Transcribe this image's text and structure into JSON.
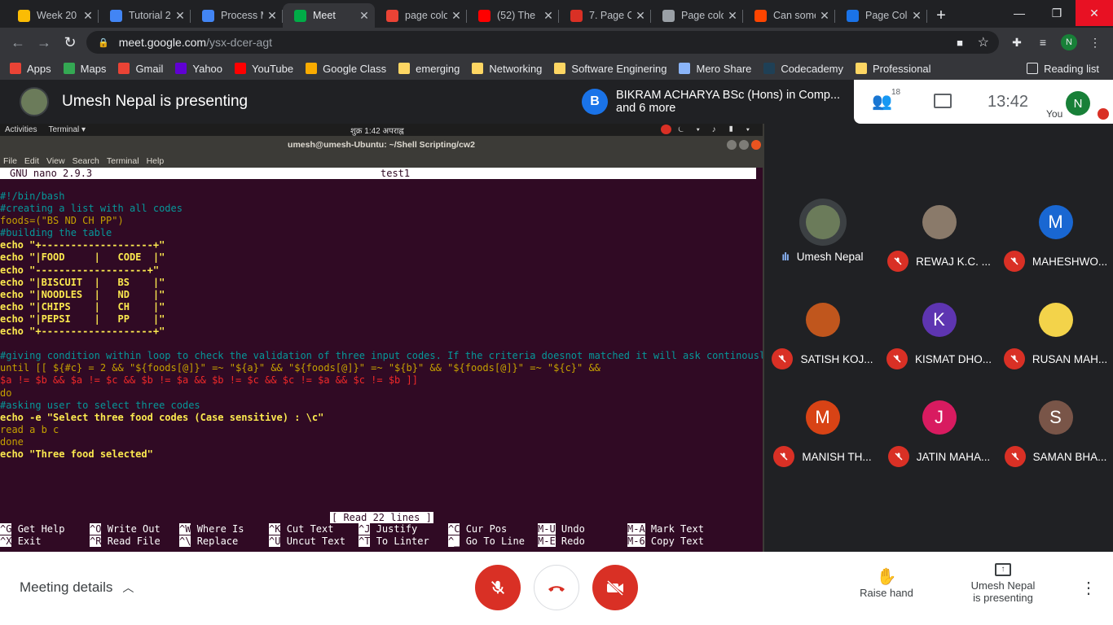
{
  "browser": {
    "tabs": [
      {
        "title": "Week 20",
        "icon": "google-drive-icon",
        "color": "#fbbc04"
      },
      {
        "title": "Tutorial 2",
        "icon": "google-docs-icon",
        "color": "#4285f4"
      },
      {
        "title": "Process M",
        "icon": "google-docs-icon",
        "color": "#4285f4"
      },
      {
        "title": "Meet",
        "icon": "google-meet-icon",
        "color": "#00ac47",
        "active": true
      },
      {
        "title": "page colo",
        "icon": "bolt-icon",
        "color": "#ea4335"
      },
      {
        "title": "(52) The",
        "icon": "youtube-icon",
        "color": "#ff0000"
      },
      {
        "title": "7. Page C",
        "icon": "red-site-icon",
        "color": "#d93025"
      },
      {
        "title": "Page colo",
        "icon": "globe-icon",
        "color": "#9aa0a6"
      },
      {
        "title": "Can some",
        "icon": "reddit-icon",
        "color": "#ff4500"
      },
      {
        "title": "Page Colo",
        "icon": "page-icon",
        "color": "#1a73e8"
      }
    ],
    "url_host": "meet.google.com",
    "url_path": "/ysx-dcer-agt",
    "profile_initial": "N",
    "bookmarks": [
      {
        "label": "Apps",
        "icon": "apps-grid-icon"
      },
      {
        "label": "Maps",
        "icon": "maps-icon"
      },
      {
        "label": "Gmail",
        "icon": "gmail-icon"
      },
      {
        "label": "Yahoo",
        "icon": "yahoo-icon"
      },
      {
        "label": "YouTube",
        "icon": "youtube-icon"
      },
      {
        "label": "Google Class",
        "icon": "classroom-icon"
      },
      {
        "label": "emerging",
        "icon": "folder-icon"
      },
      {
        "label": "Networking",
        "icon": "folder-icon"
      },
      {
        "label": "Software Enginering",
        "icon": "folder-icon"
      },
      {
        "label": "Mero Share",
        "icon": "meroshare-icon"
      },
      {
        "label": "Codecademy",
        "icon": "codecademy-icon"
      },
      {
        "label": "Professional",
        "icon": "folder-icon"
      }
    ],
    "reading_list": "Reading list"
  },
  "meet": {
    "presenter_text": "Umesh Nepal is presenting",
    "banner_initial": "B",
    "banner_line1": "BIKRAM ACHARYA BSc (Hons) in Comp...",
    "banner_line2": "and 6 more",
    "people_count": "18",
    "time": "13:42",
    "self_initial": "N",
    "self_label": "You",
    "participants": [
      {
        "name": "Umesh Nepal",
        "initial": "",
        "color": "#6b7b5a",
        "speaking": true
      },
      {
        "name": "REWAJ K.C. ...",
        "initial": "",
        "color": "#8a7a6a",
        "speaking": false
      },
      {
        "name": "MAHESHWO...",
        "initial": "M",
        "color": "#1967d2",
        "speaking": false
      },
      {
        "name": "SATISH KOJ...",
        "initial": "",
        "color": "#c0561d",
        "speaking": false
      },
      {
        "name": "KISMAT DHO...",
        "initial": "K",
        "color": "#5e35b1",
        "speaking": false
      },
      {
        "name": "RUSAN MAH...",
        "initial": "",
        "color": "#f3d34a",
        "speaking": false
      },
      {
        "name": "MANISH TH...",
        "initial": "M",
        "color": "#d84315",
        "speaking": false
      },
      {
        "name": "JATIN MAHA...",
        "initial": "J",
        "color": "#d81b60",
        "speaking": false
      },
      {
        "name": "SAMAN BHA...",
        "initial": "S",
        "color": "#795548",
        "speaking": false
      }
    ],
    "meeting_details": "Meeting details",
    "raise_hand": "Raise hand",
    "present_line1": "Umesh Nepal",
    "present_line2": "is presenting"
  },
  "terminal": {
    "activities": "Activities",
    "app_menu": "Terminal ▾",
    "clock": "शुक्र 1:42 अपराह्न",
    "title": "umesh@umesh-Ubuntu: ~/Shell Scripting/cw2",
    "menu": [
      "File",
      "Edit",
      "View",
      "Search",
      "Terminal",
      "Help"
    ],
    "nano_version": "GNU nano 2.9.3",
    "filename": "test1",
    "status": "[ Read 22 lines ]",
    "code_lines": [
      "#!/bin/bash",
      "#creating a list with all codes",
      "foods=(\"BS ND CH PP\")",
      "#building the table",
      "echo \"+-------------------+\"",
      "echo \"|FOOD     |   CODE  |\"",
      "echo \"-------------------+\"",
      "echo \"|BISCUIT  |   BS    |\"",
      "echo \"|NOODLES  |   ND    |\"",
      "echo \"|CHIPS    |   CH    |\"",
      "echo \"|PEPSI    |   PP    |\"",
      "echo \"+-------------------+\"",
      "",
      "#giving condition within loop to check the validation of three input codes. If the criteria doesnot matched it will ask continously",
      "until [[ ${#c} = 2 && \"${foods[@]}\" =~ \"${a}\" && \"${foods[@]}\" =~ \"${b}\" && \"${foods[@]}\" =~ \"${c}\" &&",
      "$a != $b && $a != $c && $b != $a && $b != $c && $c != $a && $c != $b ]]",
      "do",
      "#asking user to select three codes",
      "echo -e \"Select three food codes (Case sensitive) : \\c\"",
      "read a b c",
      "done",
      "echo \"Three food selected\""
    ],
    "shortcuts": [
      {
        "key": "^G",
        "label": "Get Help"
      },
      {
        "key": "^X",
        "label": "Exit"
      },
      {
        "key": "^O",
        "label": "Write Out"
      },
      {
        "key": "^R",
        "label": "Read File"
      },
      {
        "key": "^W",
        "label": "Where Is"
      },
      {
        "key": "^\\",
        "label": "Replace"
      },
      {
        "key": "^K",
        "label": "Cut Text"
      },
      {
        "key": "^U",
        "label": "Uncut Text"
      },
      {
        "key": "^J",
        "label": "Justify"
      },
      {
        "key": "^T",
        "label": "To Linter"
      },
      {
        "key": "^C",
        "label": "Cur Pos"
      },
      {
        "key": "^_",
        "label": "Go To Line"
      },
      {
        "key": "M-U",
        "label": "Undo"
      },
      {
        "key": "M-E",
        "label": "Redo"
      },
      {
        "key": "M-A",
        "label": "Mark Text"
      },
      {
        "key": "M-6",
        "label": "Copy Text"
      }
    ]
  }
}
